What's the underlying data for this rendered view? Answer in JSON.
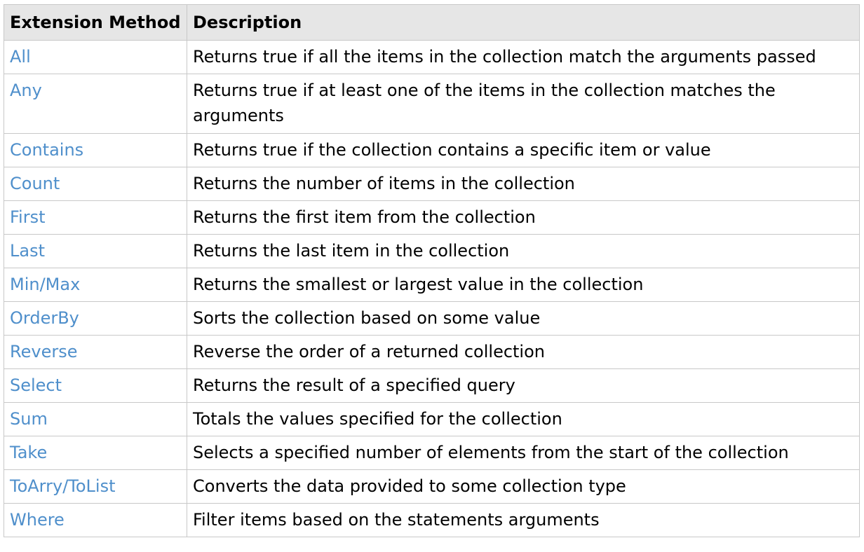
{
  "table": {
    "headers": [
      "Extension Method",
      "Description"
    ],
    "link_color": "#4f8fcb",
    "header_bg": "#e6e6e6",
    "rows": [
      {
        "method": "All",
        "description": "Returns true if all the items in the collection match the arguments passed"
      },
      {
        "method": "Any",
        "description": "Returns true if at least one of the items in the collection matches the arguments"
      },
      {
        "method": "Contains",
        "description": "Returns true if the collection contains a specific item or value"
      },
      {
        "method": "Count",
        "description": "Returns the number of items in the collection"
      },
      {
        "method": "First",
        "description": "Returns the first item from the collection"
      },
      {
        "method": "Last",
        "description": "Returns the last item in the collection"
      },
      {
        "method": "Min/Max",
        "description": "Returns the smallest or largest value in the collection"
      },
      {
        "method": "OrderBy",
        "description": "Sorts the collection based on some value"
      },
      {
        "method": "Reverse",
        "description": "Reverse the order of a returned collection"
      },
      {
        "method": "Select",
        "description": "Returns the result of a specified query"
      },
      {
        "method": "Sum",
        "description": "Totals the values specified for the collection"
      },
      {
        "method": "Take",
        "description": "Selects a specified number of elements from the start of the collection"
      },
      {
        "method": "ToArry/ToList",
        "description": "Converts the data provided to some collection type"
      },
      {
        "method": "Where",
        "description": "Filter items based on the statements arguments"
      }
    ]
  }
}
